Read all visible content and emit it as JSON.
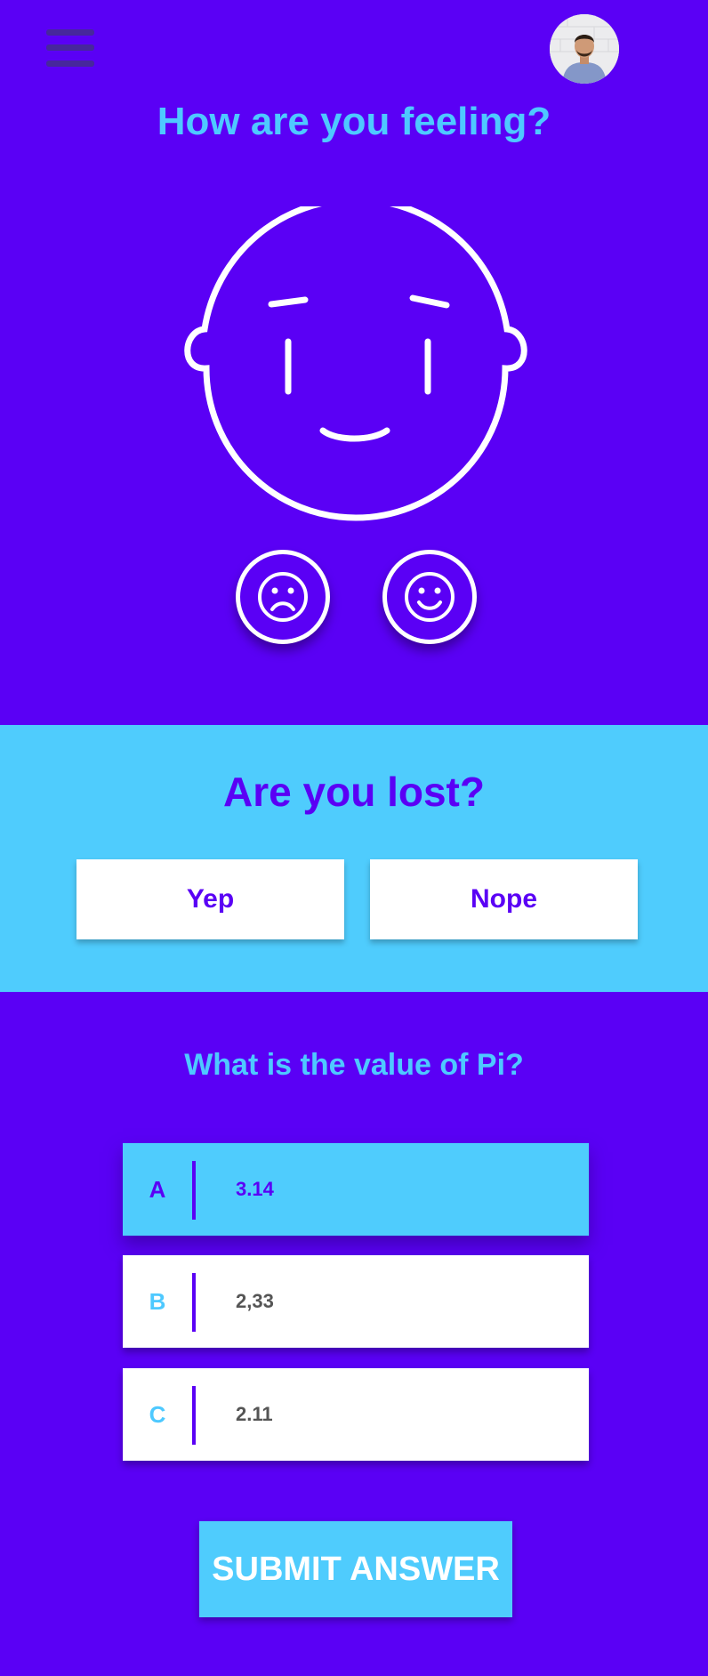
{
  "header": {
    "menu_icon": "hamburger-menu-icon",
    "avatar_icon": "user-avatar"
  },
  "mood": {
    "title": "How are you feeling?",
    "face_icon": "neutral-face-illustration",
    "sad_button_icon": "sad-face-icon",
    "happy_button_icon": "happy-face-icon"
  },
  "lost": {
    "title": "Are you lost?",
    "yes_label": "Yep",
    "no_label": "Nope"
  },
  "quiz": {
    "question": "What is the value of Pi?",
    "options": [
      {
        "letter": "A",
        "value": "3.14",
        "selected": true
      },
      {
        "letter": "B",
        "value": "2,33",
        "selected": false
      },
      {
        "letter": "C",
        "value": "2.11",
        "selected": false
      }
    ],
    "submit_label": "SUBMIT ANSWER"
  },
  "colors": {
    "background": "#5a00f5",
    "accent": "#4fccfd",
    "text_on_accent": "#5a00f5",
    "card": "#ffffff",
    "menu_icon": "#47279c"
  }
}
